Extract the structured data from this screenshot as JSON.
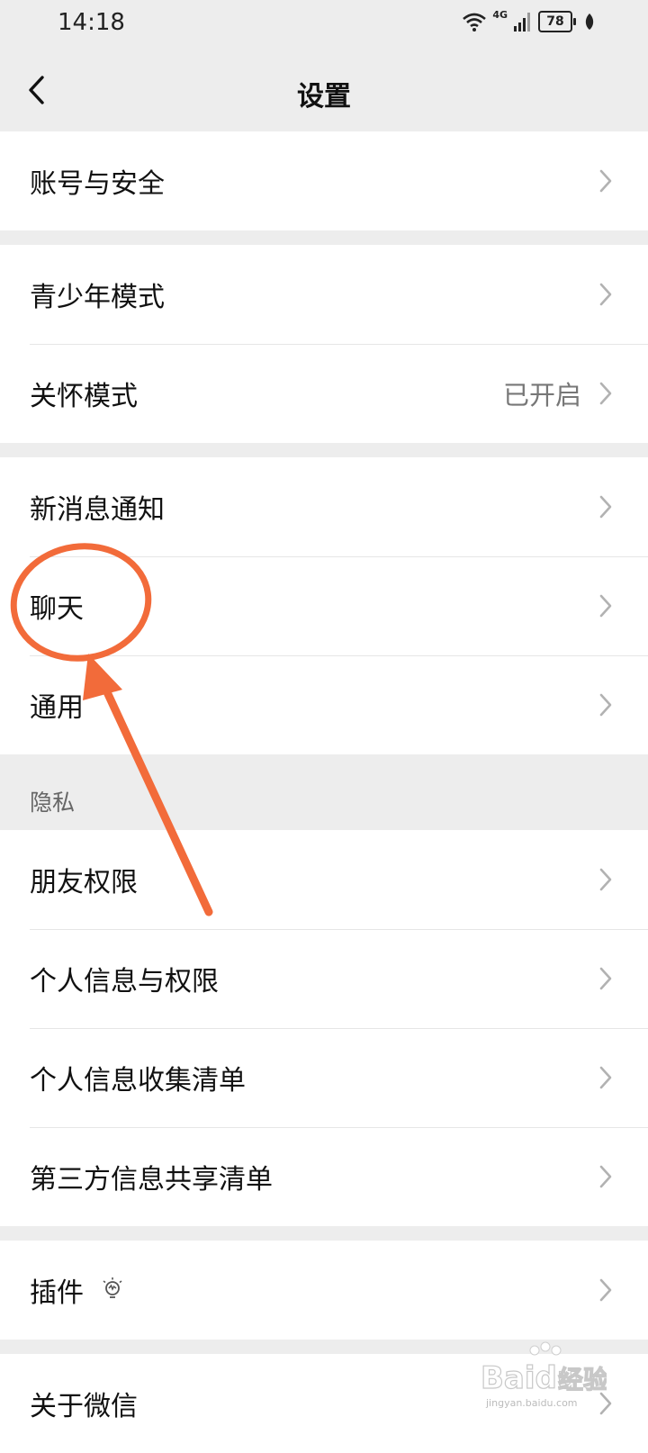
{
  "status_bar": {
    "time": "14:18",
    "network": "4G",
    "battery": "78"
  },
  "nav": {
    "title": "设置"
  },
  "groups": [
    {
      "items": [
        {
          "label": "账号与安全"
        }
      ]
    },
    {
      "items": [
        {
          "label": "青少年模式"
        },
        {
          "label": "关怀模式",
          "value": "已开启"
        }
      ]
    },
    {
      "items": [
        {
          "label": "新消息通知"
        },
        {
          "label": "聊天"
        },
        {
          "label": "通用"
        }
      ]
    },
    {
      "section_title": "隐私",
      "items": [
        {
          "label": "朋友权限"
        },
        {
          "label": "个人信息与权限"
        },
        {
          "label": "个人信息收集清单"
        },
        {
          "label": "第三方信息共享清单"
        }
      ]
    },
    {
      "items": [
        {
          "label": "插件",
          "icon": "lightbulb-icon"
        }
      ]
    },
    {
      "items": [
        {
          "label": "关于微信"
        }
      ]
    }
  ],
  "colors": {
    "page_bg": "#ededed",
    "card_bg": "#ffffff",
    "annotation": "#f26b3a",
    "chevron": "#b2b2b2"
  },
  "watermark": {
    "brand_a": "Bai",
    "brand_b": "du",
    "brand_cn": "经验",
    "url": "jingyan.baidu.com"
  }
}
